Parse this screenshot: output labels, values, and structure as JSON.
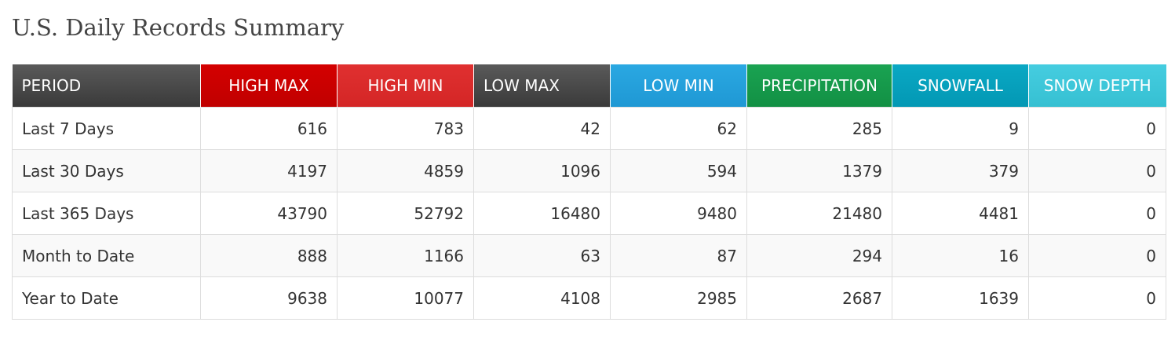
{
  "page_title": "U.S. Daily Records Summary",
  "colors": {
    "period": "#4a4a4a",
    "high_max": "#cc0000",
    "high_min": "#dd2a2a",
    "low_max": "#4a4a4a",
    "low_min": "#24a0dc",
    "precipitation": "#169a4a",
    "snowfall": "#05a0bd",
    "snow_depth": "#3cc6d8"
  },
  "table": {
    "headers": [
      "PERIOD",
      "HIGH MAX",
      "HIGH MIN",
      "LOW MAX",
      "LOW MIN",
      "PRECIPITATION",
      "SNOWFALL",
      "SNOW DEPTH"
    ],
    "rows": [
      [
        "Last 7 Days",
        "616",
        "783",
        "42",
        "62",
        "285",
        "9",
        "0"
      ],
      [
        "Last 30 Days",
        "4197",
        "4859",
        "1096",
        "594",
        "1379",
        "379",
        "0"
      ],
      [
        "Last 365 Days",
        "43790",
        "52792",
        "16480",
        "9480",
        "21480",
        "4481",
        "0"
      ],
      [
        "Month to Date",
        "888",
        "1166",
        "63",
        "87",
        "294",
        "16",
        "0"
      ],
      [
        "Year to Date",
        "9638",
        "10077",
        "4108",
        "2985",
        "2687",
        "1639",
        "0"
      ]
    ]
  }
}
